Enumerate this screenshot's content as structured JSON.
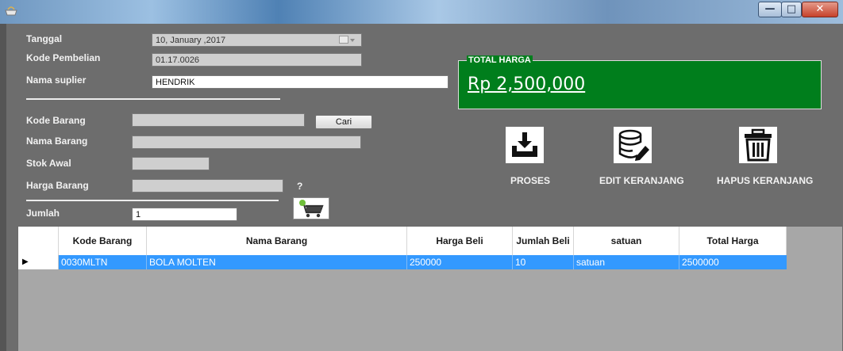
{
  "window": {
    "minimize_glyph": "—",
    "maximize_glyph": "□",
    "close_glyph": "✕"
  },
  "form": {
    "tanggal_label": "Tanggal",
    "tanggal_value": "10, January ,2017",
    "kode_pembelian_label": "Kode Pembelian",
    "kode_pembelian_value": "01.17.0026",
    "nama_suplier_label": "Nama suplier",
    "nama_suplier_value": "HENDRIK",
    "kode_barang_label": "Kode Barang",
    "kode_barang_value": "",
    "cari_label": "Cari",
    "nama_barang_label": "Nama Barang",
    "nama_barang_value": "",
    "stok_awal_label": "Stok Awal",
    "stok_awal_value": "",
    "harga_barang_label": "Harga Barang",
    "harga_barang_value": "",
    "help_mark": "?",
    "jumlah_label": "Jumlah",
    "jumlah_value": "1"
  },
  "total": {
    "legend": "TOTAL HARGA",
    "value": "Rp 2,500,000",
    "background_color": "#007e1c"
  },
  "actions": [
    {
      "label": "PROSES",
      "icon": "download-tray-icon"
    },
    {
      "label": "EDIT KERANJANG",
      "icon": "database-edit-icon"
    },
    {
      "label": "HAPUS KERANJANG",
      "icon": "trash-icon"
    }
  ],
  "cart_button_icon": "add-to-cart-icon",
  "grid": {
    "columns": [
      "Kode Barang",
      "Nama Barang",
      "Harga Beli",
      "Jumlah Beli",
      "satuan",
      "Total Harga"
    ],
    "rows": [
      {
        "kode": "0030MLTN",
        "nama": "BOLA MOLTEN",
        "harga": "250000",
        "jumlah": "10",
        "satuan": "satuan",
        "total": "2500000"
      }
    ],
    "selection_color": "#3399ff"
  }
}
